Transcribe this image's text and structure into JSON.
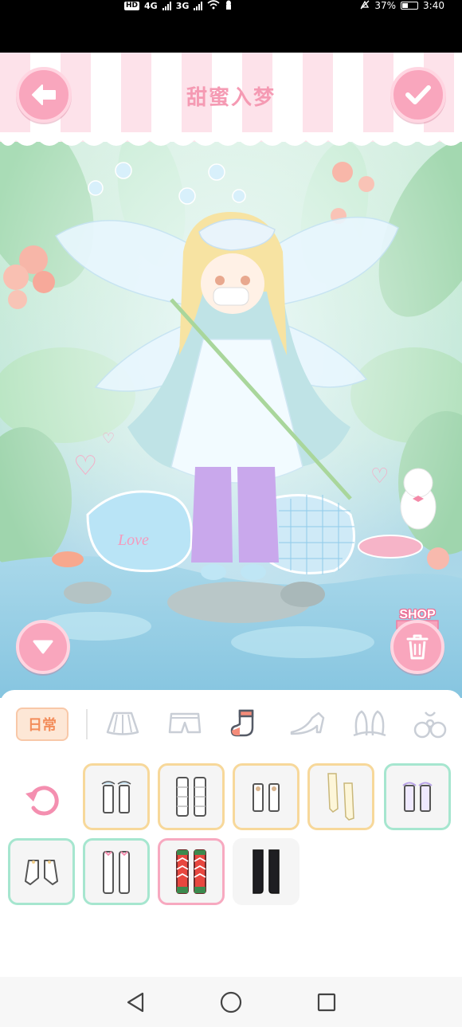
{
  "status_bar": {
    "hd_label": "HD",
    "net_1": "4G",
    "net_2": "3G",
    "battery_text": "37%",
    "time": "3:40"
  },
  "header": {
    "title": "甜蜜入梦"
  },
  "shop": {
    "label": "SHOP"
  },
  "category_tabs": [
    {
      "label": "日常",
      "active": true
    },
    {
      "icon": "skirt-icon"
    },
    {
      "icon": "shorts-icon"
    },
    {
      "icon": "sock-icon",
      "selected": true
    },
    {
      "icon": "shoe-icon"
    },
    {
      "icon": "bunny-ears-icon"
    },
    {
      "icon": "bow-accessory-icon"
    }
  ],
  "items": [
    {
      "name": "white-frill-socks",
      "border": "yellow"
    },
    {
      "name": "white-leg-warmers",
      "border": "yellow"
    },
    {
      "name": "white-bead-socks",
      "border": "yellow"
    },
    {
      "name": "cream-stockings",
      "border": "yellow"
    },
    {
      "name": "lavender-frill-socks",
      "border": "green"
    },
    {
      "name": "white-short-socks",
      "border": "green"
    },
    {
      "name": "white-ribbon-stockings",
      "border": "green"
    },
    {
      "name": "red-knit-socks",
      "border": "pink",
      "selected": true
    },
    {
      "name": "black-knee-socks",
      "border": "none"
    }
  ],
  "colors": {
    "accent_pink": "#f9a6bd",
    "title_pink": "#f59ab3",
    "tab_orange": "#f38d5b"
  }
}
